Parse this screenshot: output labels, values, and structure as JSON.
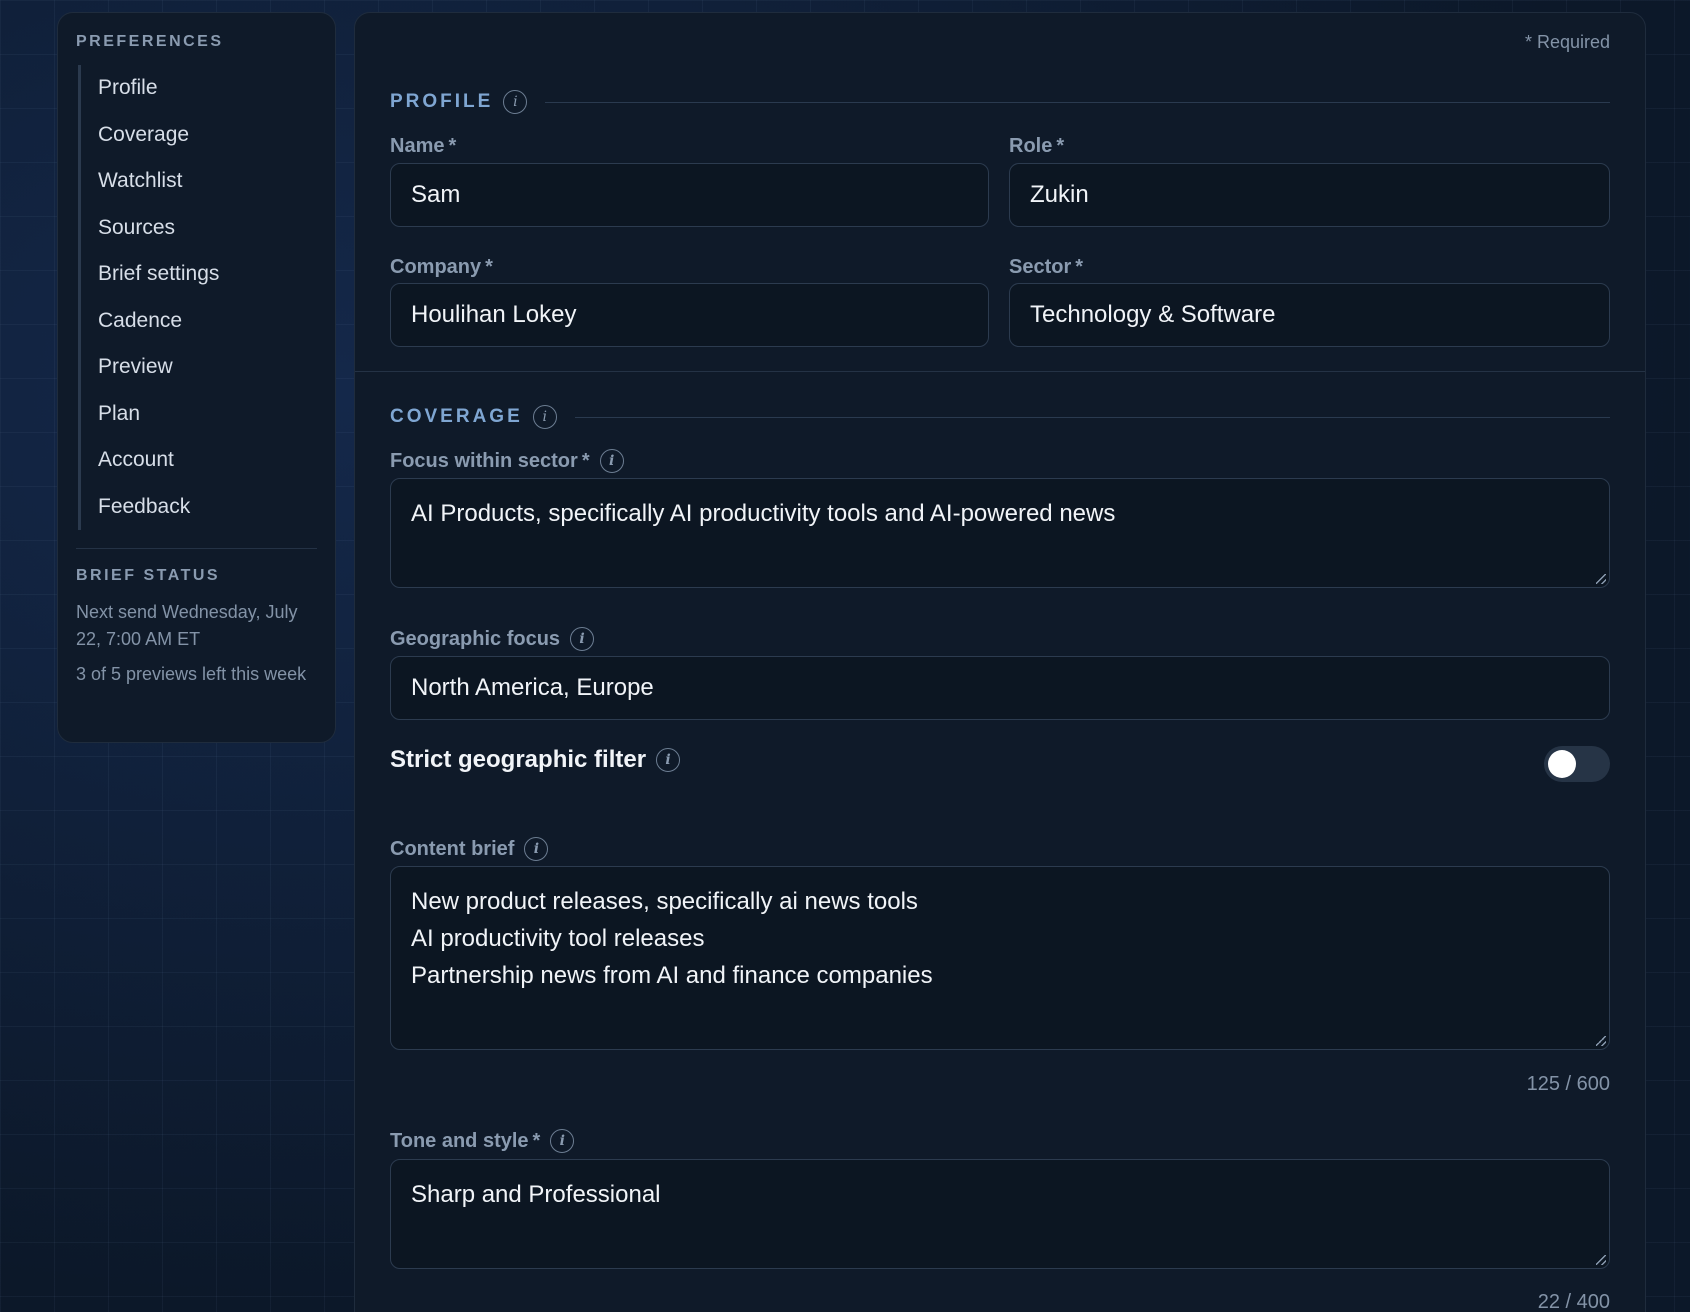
{
  "sidebar": {
    "heading": "PREFERENCES",
    "items": [
      {
        "label": "Profile"
      },
      {
        "label": "Coverage"
      },
      {
        "label": "Watchlist"
      },
      {
        "label": "Sources"
      },
      {
        "label": "Brief settings"
      },
      {
        "label": "Cadence"
      },
      {
        "label": "Preview"
      },
      {
        "label": "Plan"
      },
      {
        "label": "Account"
      },
      {
        "label": "Feedback"
      }
    ],
    "status_heading": "BRIEF STATUS",
    "next_send": "Next send Wednesday, July 22, 7:00 AM ET",
    "previews_left": "3 of 5 previews left this week"
  },
  "form": {
    "required_note": "* Required",
    "profile": {
      "title": "PROFILE",
      "name_label": "Name",
      "name_value": "Sam",
      "role_label": "Role",
      "role_value": "Zukin",
      "company_label": "Company",
      "company_value": "Houlihan Lokey",
      "sector_label": "Sector",
      "sector_value": "Technology & Software"
    },
    "coverage": {
      "title": "COVERAGE",
      "focus_label": "Focus within sector",
      "focus_value": "AI Products, specifically AI productivity tools and AI-powered news",
      "geo_label": "Geographic focus",
      "geo_value": "North America, Europe",
      "strict_label": "Strict geographic filter",
      "strict_on": false,
      "brief_label": "Content brief",
      "brief_lines": [
        "New product releases, specifically ai news tools",
        "AI productivity tool releases",
        "Partnership news from AI and finance companies"
      ],
      "brief_counter": "125 / 600",
      "tone_label": "Tone and style",
      "tone_value": "Sharp and Professional",
      "tone_counter": "22 / 400"
    },
    "required_marker": "*",
    "info_glyph": "i"
  },
  "colors": {
    "accent": "#7fa6d2",
    "panel_bg": "#0f1a29",
    "page_bg": "#0d1a2e"
  },
  "icons": {
    "info": "info-icon",
    "resize": "resize-handle-icon"
  }
}
